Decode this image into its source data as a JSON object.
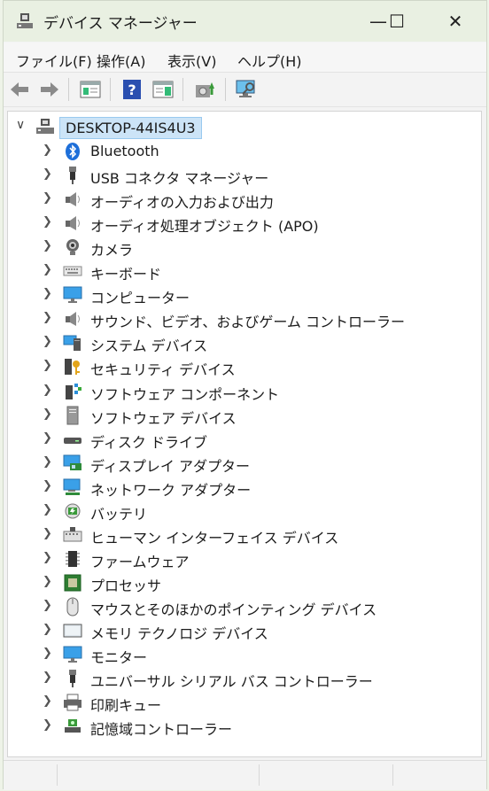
{
  "window": {
    "title": "デバイス マネージャー",
    "controls": {
      "minimize": "—",
      "maximize": "☐",
      "close": "✕"
    }
  },
  "menu": [
    {
      "label": "ファイル(F)"
    },
    {
      "label": "操作(A)"
    },
    {
      "label": "表示(V)"
    },
    {
      "label": "ヘルプ(H)"
    }
  ],
  "toolbar": {
    "buttons": [
      "back-icon",
      "forward-icon",
      "properties-window-icon",
      "help-icon",
      "action-pane-icon",
      "update-driver-icon",
      "scan-hardware-icon"
    ]
  },
  "tree": {
    "root": {
      "label": "DESKTOP-44IS4U3",
      "expanded": true
    },
    "items": [
      {
        "label": "Bluetooth",
        "icon": "bluetooth-icon"
      },
      {
        "label": "USB コネクタ マネージャー",
        "icon": "usb-icon"
      },
      {
        "label": "オーディオの入力および出力",
        "icon": "speaker-icon"
      },
      {
        "label": "オーディオ処理オブジェクト (APO)",
        "icon": "speaker-icon"
      },
      {
        "label": "カメラ",
        "icon": "camera-icon"
      },
      {
        "label": "キーボード",
        "icon": "keyboard-icon"
      },
      {
        "label": "コンピューター",
        "icon": "monitor-icon"
      },
      {
        "label": "サウンド、ビデオ、およびゲーム コントローラー",
        "icon": "speaker-icon"
      },
      {
        "label": "システム デバイス",
        "icon": "system-device-icon"
      },
      {
        "label": "セキュリティ デバイス",
        "icon": "key-icon"
      },
      {
        "label": "ソフトウェア コンポーネント",
        "icon": "software-component-icon"
      },
      {
        "label": "ソフトウェア デバイス",
        "icon": "software-device-icon"
      },
      {
        "label": "ディスク ドライブ",
        "icon": "disk-drive-icon"
      },
      {
        "label": "ディスプレイ アダプター",
        "icon": "display-adapter-icon"
      },
      {
        "label": "ネットワーク アダプター",
        "icon": "network-adapter-icon"
      },
      {
        "label": "バッテリ",
        "icon": "battery-icon"
      },
      {
        "label": "ヒューマン インターフェイス デバイス",
        "icon": "hid-icon"
      },
      {
        "label": "ファームウェア",
        "icon": "firmware-icon"
      },
      {
        "label": "プロセッサ",
        "icon": "processor-icon"
      },
      {
        "label": "マウスとそのほかのポインティング デバイス",
        "icon": "mouse-icon"
      },
      {
        "label": "メモリ テクノロジ デバイス",
        "icon": "memory-icon"
      },
      {
        "label": "モニター",
        "icon": "monitor-icon"
      },
      {
        "label": "ユニバーサル シリアル バス コントローラー",
        "icon": "usb-icon"
      },
      {
        "label": "印刷キュー",
        "icon": "printer-icon"
      },
      {
        "label": "記憶域コントローラー",
        "icon": "storage-controller-icon"
      }
    ]
  },
  "colors": {
    "titlebar": "#e9f0e2",
    "selection": "#cce4f7",
    "accent": "#0078d4"
  }
}
